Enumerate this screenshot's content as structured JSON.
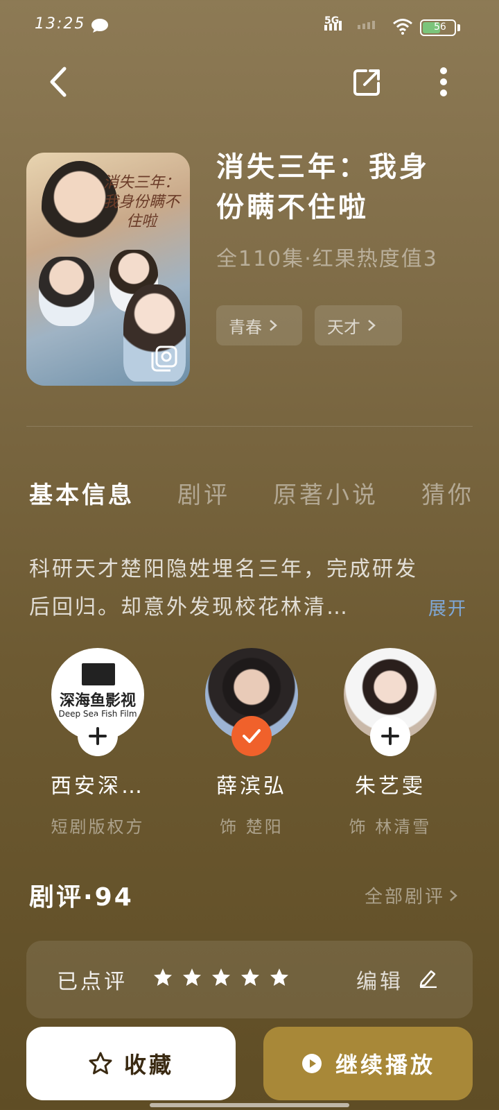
{
  "status_bar": {
    "time": "13:25",
    "network": "5G",
    "battery": "56",
    "battery_level": 0.56
  },
  "nav": {
    "back_icon": "chevron-left-icon",
    "share_icon": "share-icon",
    "more_icon": "more-vertical-icon"
  },
  "drama": {
    "poster_title": "消失三年：我身份瞒不住啦",
    "title": "消失三年：我身份瞒不住啦",
    "meta": "全110集·红果热度值3",
    "tags": [
      {
        "label": "青春"
      },
      {
        "label": "天才"
      }
    ]
  },
  "tabs": [
    {
      "label": "基本信息",
      "active": true
    },
    {
      "label": "剧评",
      "active": false
    },
    {
      "label": "原著小说",
      "active": false
    },
    {
      "label": "猜你",
      "active": false
    }
  ],
  "synopsis": {
    "line1": "科研天才楚阳隐姓埋名三年，完成研发",
    "line2": "后回归。却意外发现校花林清…",
    "expand": "展开"
  },
  "cast": [
    {
      "name": "西安深…",
      "role": "短剧版权方",
      "logo_cn": "深海鱼影视",
      "logo_en": "Deep Sea Fish Film",
      "followed": false
    },
    {
      "name": "薛滨弘",
      "role": "饰 楚阳",
      "followed": true
    },
    {
      "name": "朱艺雯",
      "role": "饰 林清雪",
      "followed": false
    }
  ],
  "reviews": {
    "heading": "剧评·94",
    "all_link": "全部剧评",
    "rated_label": "已点评",
    "stars": 5,
    "edit_label": "编辑"
  },
  "actions": {
    "favorite": "收藏",
    "play": "继续播放"
  },
  "colors": {
    "accent_play": "#a88838",
    "followed_badge": "#f0612b",
    "expand_link": "#7fa8d8"
  }
}
